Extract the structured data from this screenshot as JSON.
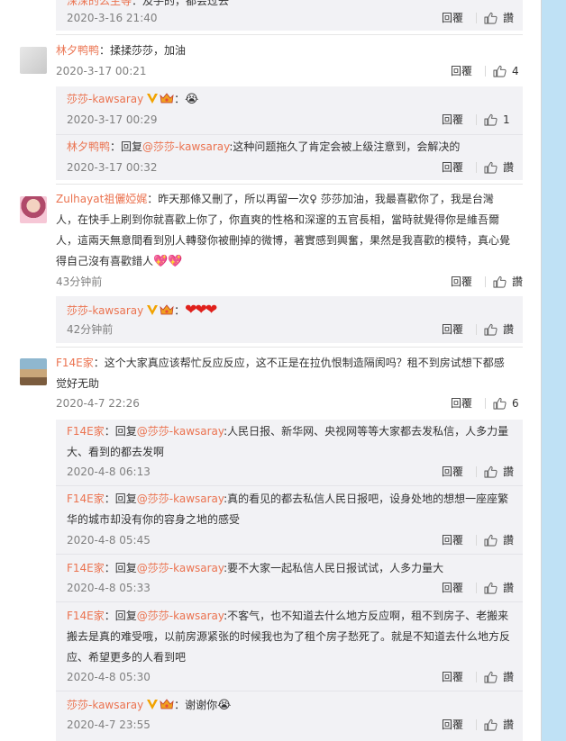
{
  "top": {
    "name": "深深的么主等",
    "text": "：及手的，都会过去",
    "time": "2020-3-16 21:40",
    "reply": "回覆",
    "like": "讚"
  },
  "c1": {
    "name": "林夕鸭鸭",
    "text": "：揉揉莎莎，加油",
    "time": "2020-3-17 00:21",
    "reply": "回覆",
    "likes": "4",
    "subs": [
      {
        "name": "莎莎-kawsaray",
        "text": "：",
        "time": "2020-3-17 00:29",
        "reply": "回覆",
        "like": "1"
      },
      {
        "name": "林夕鸭鸭",
        "pre": "：回复",
        "at": "@莎莎-kawsaray",
        "text": ":这种问题拖久了肯定会被上级注意到，会解决的",
        "time": "2020-3-17 00:32",
        "reply": "回覆",
        "like": "讚"
      }
    ]
  },
  "c2": {
    "name": "Zulhayat祖儷婭娓",
    "text": "：昨天那條又刪了，所以再留一次♀ 莎莎加油，我最喜歡你了，我是台灣人，在快手上刷到你就喜歡上你了，你直爽的性格和深邃的五官長相，當時就覺得你是維吾爾人，這兩天無意間看到別人轉發你被刪掉的微博，著實感到興奮，果然是我喜歡的模特，真心覺得自己沒有喜歡錯人",
    "time": "43分钟前",
    "reply": "回覆",
    "like": "讚",
    "subs": [
      {
        "name": "莎莎-kawsaray",
        "text": "：",
        "time": "42分钟前",
        "reply": "回覆",
        "like": "讚"
      }
    ]
  },
  "c3": {
    "name": "F14E家",
    "text": "：这个大家真应该帮忙反应反应，这不正是在拉仇恨制造隔阂吗？租不到房试想下都感觉好无助",
    "time": "2020-4-7 22:26",
    "reply": "回覆",
    "likes": "6",
    "subs": [
      {
        "name": "F14E家",
        "pre": "：回复",
        "at": "@莎莎-kawsaray",
        "text": ":人民日报、新华网、央视网等等大家都去发私信，人多力量大、看到的都去发啊",
        "time": "2020-4-8 06:13",
        "reply": "回覆",
        "like": "讚"
      },
      {
        "name": "F14E家",
        "pre": "：回复",
        "at": "@莎莎-kawsaray",
        "text": ":真的看见的都去私信人民日报吧，设身处地的想想一座座繁华的城市却没有你的容身之地的感受",
        "time": "2020-4-8 05:45",
        "reply": "回覆",
        "like": "讚"
      },
      {
        "name": "F14E家",
        "pre": "：回复",
        "at": "@莎莎-kawsaray",
        "text": ":要不大家一起私信人民日报试试，人多力量大",
        "time": "2020-4-8 05:33",
        "reply": "回覆",
        "like": "讚"
      },
      {
        "name": "F14E家",
        "pre": "：回复",
        "at": "@莎莎-kawsaray",
        "text": ":不客气，也不知道去什么地方反应啊，租不到房子、老搬来搬去是真的难受哦，以前房源紧张的时候我也为了租个房子愁死了。就是不知道去什么地方反应、希望更多的人看到吧",
        "time": "2020-4-8 05:30",
        "reply": "回覆",
        "like": "讚"
      },
      {
        "name": "莎莎-kawsaray",
        "text": "：谢谢你",
        "time": "2020-4-7 23:55",
        "reply": "回覆",
        "like": "讚"
      }
    ]
  },
  "colors": {
    "accent": "#eb7350",
    "bg_side": "#bfe1f5",
    "sub_bg": "#f2f2f5"
  }
}
